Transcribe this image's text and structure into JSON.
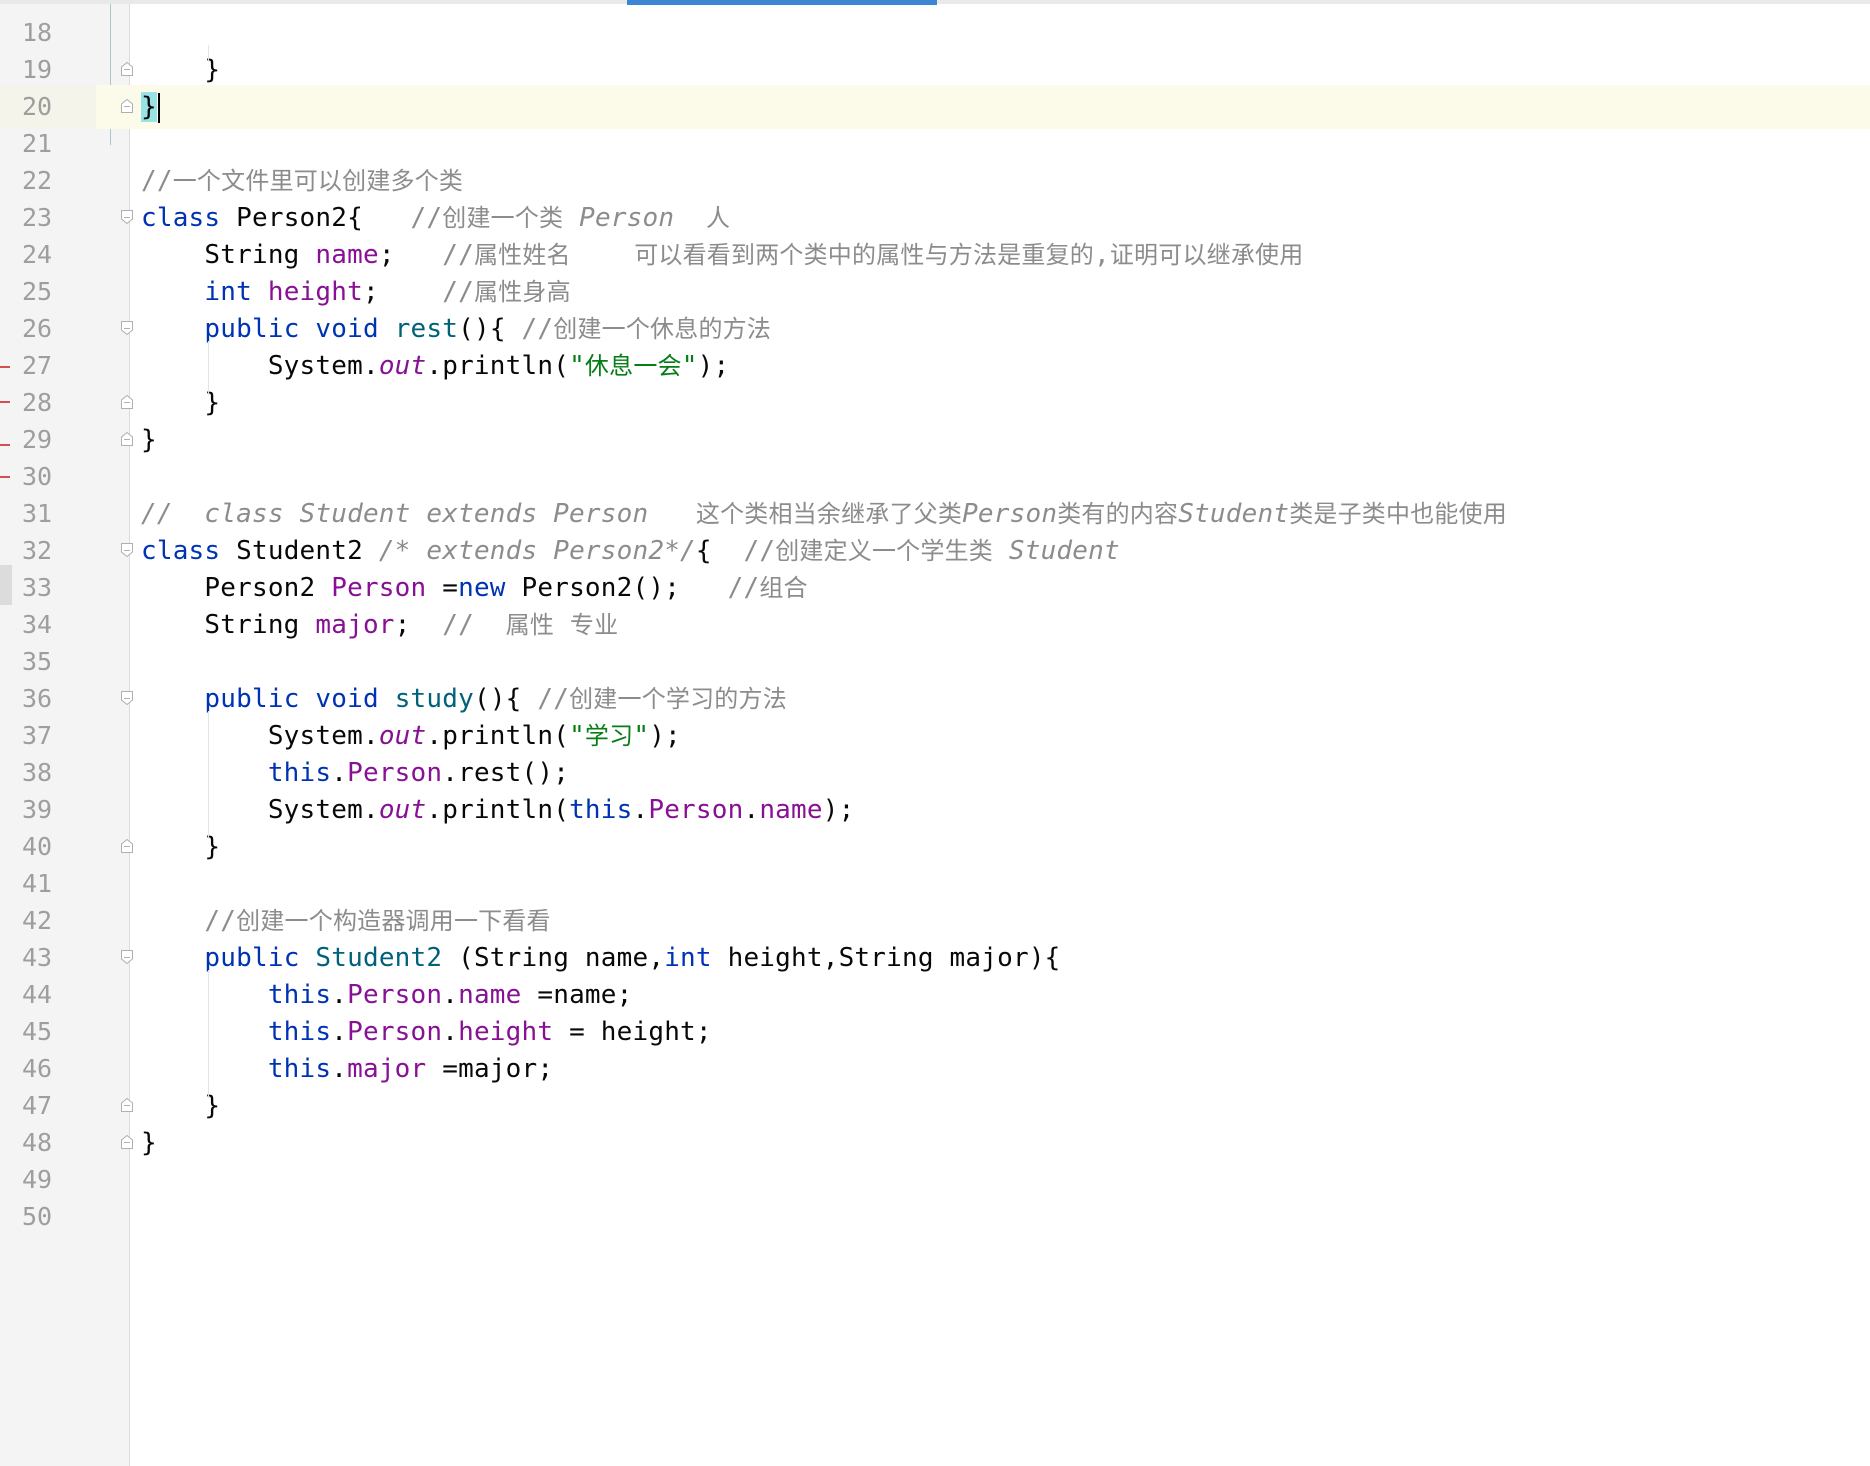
{
  "editor": {
    "current_line": 20,
    "lines": [
      {
        "num": "18",
        "fold": false,
        "tokens": []
      },
      {
        "num": "19",
        "fold": "end",
        "tokens": [
          {
            "t": "    }",
            "c": "n"
          }
        ]
      },
      {
        "num": "20",
        "fold": "end",
        "tokens": [
          {
            "t": "}",
            "c": "n",
            "hl": true
          }
        ]
      },
      {
        "num": "21",
        "fold": false,
        "tokens": []
      },
      {
        "num": "22",
        "fold": false,
        "tokens": [
          {
            "t": "//一个文件里可以创建多个类",
            "c": "c"
          }
        ]
      },
      {
        "num": "23",
        "fold": "start",
        "tokens": [
          {
            "t": "class",
            "c": "k"
          },
          {
            "t": " Person2{   ",
            "c": "n"
          },
          {
            "t": "//创建一个类 ",
            "c": "c"
          },
          {
            "t": "Person",
            "c": "ci"
          },
          {
            "t": "  人",
            "c": "c"
          }
        ]
      },
      {
        "num": "24",
        "fold": false,
        "tokens": [
          {
            "t": "    String ",
            "c": "n"
          },
          {
            "t": "name",
            "c": "m"
          },
          {
            "t": ";   ",
            "c": "n"
          },
          {
            "t": "//属性姓名    可以看看到两个类中的属性与方法是重复的,证明可以继承使用",
            "c": "c"
          }
        ]
      },
      {
        "num": "25",
        "fold": false,
        "tokens": [
          {
            "t": "    ",
            "c": "n"
          },
          {
            "t": "int",
            "c": "k"
          },
          {
            "t": " ",
            "c": "n"
          },
          {
            "t": "height",
            "c": "m"
          },
          {
            "t": ";    ",
            "c": "n"
          },
          {
            "t": "//属性身高",
            "c": "c"
          }
        ]
      },
      {
        "num": "26",
        "fold": "start",
        "tokens": [
          {
            "t": "    ",
            "c": "n"
          },
          {
            "t": "public",
            "c": "k"
          },
          {
            "t": " ",
            "c": "n"
          },
          {
            "t": "void",
            "c": "k"
          },
          {
            "t": " ",
            "c": "n"
          },
          {
            "t": "rest",
            "c": "f"
          },
          {
            "t": "(){ ",
            "c": "n"
          },
          {
            "t": "//创建一个休息的方法",
            "c": "c"
          }
        ]
      },
      {
        "num": "27",
        "fold": false,
        "tokens": [
          {
            "t": "        System.",
            "c": "n"
          },
          {
            "t": "out",
            "c": "st"
          },
          {
            "t": ".println(",
            "c": "n"
          },
          {
            "t": "\"休息一会\"",
            "c": "s"
          },
          {
            "t": ");",
            "c": "n"
          }
        ]
      },
      {
        "num": "28",
        "fold": "end",
        "tokens": [
          {
            "t": "    }",
            "c": "n"
          }
        ]
      },
      {
        "num": "29",
        "fold": "end",
        "tokens": [
          {
            "t": "}",
            "c": "n"
          }
        ]
      },
      {
        "num": "30",
        "fold": false,
        "tokens": []
      },
      {
        "num": "31",
        "fold": false,
        "tokens": [
          {
            "t": "//  class Student extends Person   ",
            "c": "ci"
          },
          {
            "t": "这个类相当余继承了父类",
            "c": "c"
          },
          {
            "t": "Person",
            "c": "ci"
          },
          {
            "t": "类有的内容",
            "c": "c"
          },
          {
            "t": "Student",
            "c": "ci"
          },
          {
            "t": "类是子类中也能使用",
            "c": "c"
          }
        ]
      },
      {
        "num": "32",
        "fold": "start",
        "tokens": [
          {
            "t": "class",
            "c": "k"
          },
          {
            "t": " Student2 ",
            "c": "n"
          },
          {
            "t": "/* extends Person2*/",
            "c": "ci"
          },
          {
            "t": "{  ",
            "c": "n"
          },
          {
            "t": "//创建定义一个学生类 ",
            "c": "c"
          },
          {
            "t": "Student",
            "c": "ci"
          }
        ]
      },
      {
        "num": "33",
        "fold": false,
        "tokens": [
          {
            "t": "    Person2 ",
            "c": "n"
          },
          {
            "t": "Person",
            "c": "m"
          },
          {
            "t": " =",
            "c": "n"
          },
          {
            "t": "new",
            "c": "k"
          },
          {
            "t": " Person2();   ",
            "c": "n"
          },
          {
            "t": "//组合",
            "c": "c"
          }
        ]
      },
      {
        "num": "34",
        "fold": false,
        "tokens": [
          {
            "t": "    String ",
            "c": "n"
          },
          {
            "t": "major",
            "c": "m"
          },
          {
            "t": ";  ",
            "c": "n"
          },
          {
            "t": "//  属性 专业",
            "c": "c"
          }
        ]
      },
      {
        "num": "35",
        "fold": false,
        "tokens": []
      },
      {
        "num": "36",
        "fold": "start",
        "tokens": [
          {
            "t": "    ",
            "c": "n"
          },
          {
            "t": "public",
            "c": "k"
          },
          {
            "t": " ",
            "c": "n"
          },
          {
            "t": "void",
            "c": "k"
          },
          {
            "t": " ",
            "c": "n"
          },
          {
            "t": "study",
            "c": "f"
          },
          {
            "t": "(){ ",
            "c": "n"
          },
          {
            "t": "//创建一个学习的方法",
            "c": "c"
          }
        ]
      },
      {
        "num": "37",
        "fold": false,
        "tokens": [
          {
            "t": "        System.",
            "c": "n"
          },
          {
            "t": "out",
            "c": "st"
          },
          {
            "t": ".println(",
            "c": "n"
          },
          {
            "t": "\"学习\"",
            "c": "s"
          },
          {
            "t": ");",
            "c": "n"
          }
        ]
      },
      {
        "num": "38",
        "fold": false,
        "tokens": [
          {
            "t": "        ",
            "c": "n"
          },
          {
            "t": "this",
            "c": "k"
          },
          {
            "t": ".",
            "c": "n"
          },
          {
            "t": "Person",
            "c": "m"
          },
          {
            "t": ".rest();",
            "c": "n"
          }
        ]
      },
      {
        "num": "39",
        "fold": false,
        "tokens": [
          {
            "t": "        System.",
            "c": "n"
          },
          {
            "t": "out",
            "c": "st"
          },
          {
            "t": ".println(",
            "c": "n"
          },
          {
            "t": "this",
            "c": "k"
          },
          {
            "t": ".",
            "c": "n"
          },
          {
            "t": "Person",
            "c": "m"
          },
          {
            "t": ".",
            "c": "n"
          },
          {
            "t": "name",
            "c": "m"
          },
          {
            "t": ");",
            "c": "n"
          }
        ]
      },
      {
        "num": "40",
        "fold": "end",
        "tokens": [
          {
            "t": "    }",
            "c": "n"
          }
        ]
      },
      {
        "num": "41",
        "fold": false,
        "tokens": []
      },
      {
        "num": "42",
        "fold": false,
        "tokens": [
          {
            "t": "    ",
            "c": "n"
          },
          {
            "t": "//创建一个构造器调用一下看看",
            "c": "c"
          }
        ]
      },
      {
        "num": "43",
        "fold": "start",
        "tokens": [
          {
            "t": "    ",
            "c": "n"
          },
          {
            "t": "public",
            "c": "k"
          },
          {
            "t": " ",
            "c": "n"
          },
          {
            "t": "Student2",
            "c": "f"
          },
          {
            "t": " (String name,",
            "c": "n"
          },
          {
            "t": "int",
            "c": "k"
          },
          {
            "t": " height,String major){",
            "c": "n"
          }
        ]
      },
      {
        "num": "44",
        "fold": false,
        "tokens": [
          {
            "t": "        ",
            "c": "n"
          },
          {
            "t": "this",
            "c": "k"
          },
          {
            "t": ".",
            "c": "n"
          },
          {
            "t": "Person",
            "c": "m"
          },
          {
            "t": ".",
            "c": "n"
          },
          {
            "t": "name",
            "c": "m"
          },
          {
            "t": " =name;",
            "c": "n"
          }
        ]
      },
      {
        "num": "45",
        "fold": false,
        "tokens": [
          {
            "t": "        ",
            "c": "n"
          },
          {
            "t": "this",
            "c": "k"
          },
          {
            "t": ".",
            "c": "n"
          },
          {
            "t": "Person",
            "c": "m"
          },
          {
            "t": ".",
            "c": "n"
          },
          {
            "t": "height",
            "c": "m"
          },
          {
            "t": " = height;",
            "c": "n"
          }
        ]
      },
      {
        "num": "46",
        "fold": false,
        "tokens": [
          {
            "t": "        ",
            "c": "n"
          },
          {
            "t": "this",
            "c": "k"
          },
          {
            "t": ".",
            "c": "n"
          },
          {
            "t": "major",
            "c": "m"
          },
          {
            "t": " =major;",
            "c": "n"
          }
        ]
      },
      {
        "num": "47",
        "fold": "end",
        "tokens": [
          {
            "t": "    }",
            "c": "n"
          }
        ]
      },
      {
        "num": "48",
        "fold": "end",
        "tokens": [
          {
            "t": "}",
            "c": "n"
          }
        ]
      },
      {
        "num": "49",
        "fold": false,
        "tokens": []
      },
      {
        "num": "50",
        "fold": false,
        "tokens": []
      }
    ]
  }
}
